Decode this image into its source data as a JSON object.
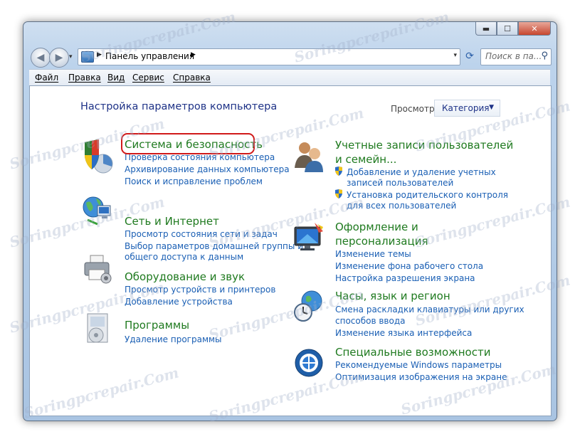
{
  "window": {
    "caption_buttons": {
      "minimize": "▬",
      "maximize": "☐",
      "close": "✕"
    }
  },
  "nav": {
    "back_icon": "◀",
    "forward_icon": "▶",
    "history_dropdown": "▾",
    "address": {
      "crumb_sep1": "▶",
      "crumb": "Панель управления",
      "crumb_sep2": "▶",
      "dropdown": "▾"
    },
    "refresh_icon": "⟳",
    "search": {
      "placeholder": "Поиск в па...",
      "icon": "search-icon"
    }
  },
  "menu": [
    "Файл",
    "Правка",
    "Вид",
    "Сервис",
    "Справка"
  ],
  "header": {
    "title": "Настройка параметров компьютера",
    "view_label": "Просмотр:",
    "view_value": "Категория"
  },
  "left": [
    {
      "title": "Система и безопасность",
      "links": [
        "Проверка состояния компьютера",
        "Архивирование данных компьютера",
        "Поиск и исправление проблем"
      ],
      "icon": "security-shield-icon"
    },
    {
      "title": "Сеть и Интернет",
      "links": [
        "Просмотр состояния сети и задач",
        "Выбор параметров домашней группы и",
        "общего доступа к данным"
      ],
      "icon": "network-globe-icon"
    },
    {
      "title": "Оборудование и звук",
      "links": [
        "Просмотр устройств и принтеров",
        "Добавление устройства"
      ],
      "icon": "printer-icon"
    },
    {
      "title": "Программы",
      "links": [
        "Удаление программы"
      ],
      "icon": "programs-icon"
    }
  ],
  "right": [
    {
      "title_lines": [
        "Учетные записи пользователей",
        "и семейн..."
      ],
      "links": [
        "Добавление и удаление учетных",
        "записей пользователей",
        "Установка родительского контроля",
        "для всех пользователей"
      ],
      "icon": "users-icon"
    },
    {
      "title_lines": [
        "Оформление и",
        "персонализация"
      ],
      "links": [
        "Изменение темы",
        "Изменение фона рабочего стола",
        "Настройка разрешения экрана"
      ],
      "icon": "monitor-icon"
    },
    {
      "title_lines": [
        "Часы, язык и регион"
      ],
      "links": [
        "Смена раскладки клавиатуры или других",
        "способов ввода",
        "Изменение языка интерфейса"
      ],
      "icon": "clock-globe-icon"
    },
    {
      "title_lines": [
        "Специальные возможности"
      ],
      "links": [
        "Рекомендуемые Windows параметры",
        "Оптимизация изображения на экране"
      ],
      "icon": "accessibility-icon"
    }
  ],
  "watermark": "Soringpcrepair.Com",
  "colors": {
    "category_title": "#1f7a1f",
    "link": "#1a5fb4",
    "page_title": "#1e3287",
    "highlight": "#d11a1a"
  }
}
